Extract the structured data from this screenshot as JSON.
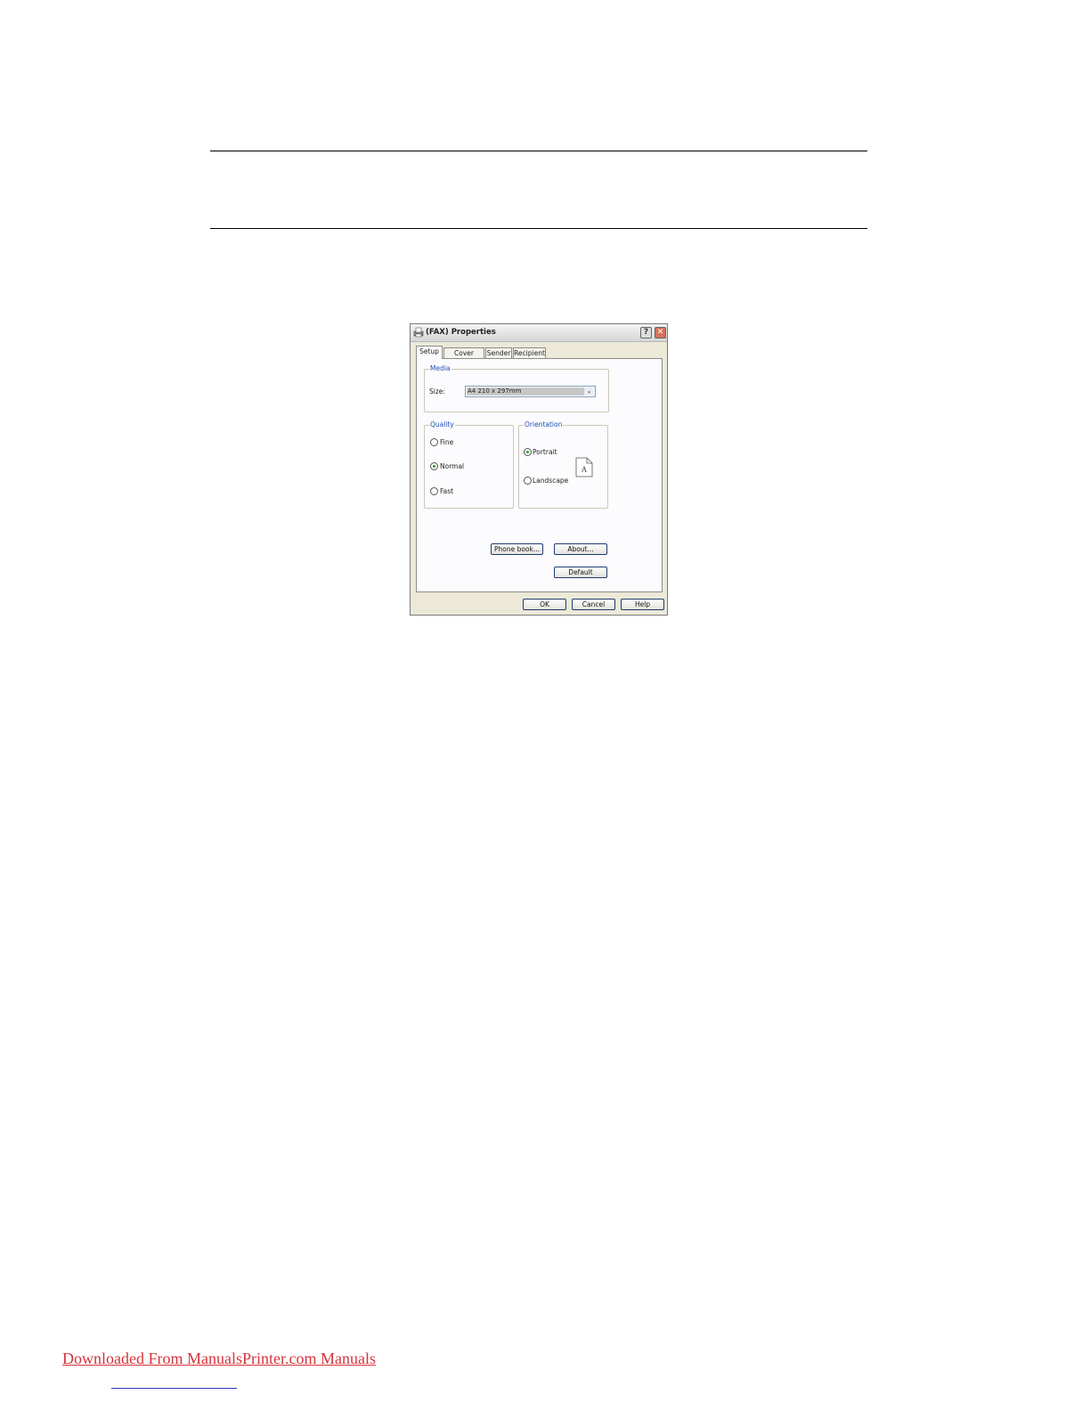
{
  "dialog": {
    "title": "(FAX) Properties",
    "help_button": "?",
    "close_button": "✕",
    "tabs": [
      {
        "label": "Setup",
        "active": true
      },
      {
        "label": "Cover Sheet",
        "active": false
      },
      {
        "label": "Sender",
        "active": false
      },
      {
        "label": "Recipient",
        "active": false
      }
    ],
    "media": {
      "legend": "Media",
      "size_label": "Size:",
      "size_value": "A4 210 x 297mm"
    },
    "quality": {
      "legend": "Quality",
      "options": [
        {
          "label": "Fine",
          "checked": false
        },
        {
          "label": "Normal",
          "checked": true
        },
        {
          "label": "Fast",
          "checked": false
        }
      ]
    },
    "orientation": {
      "legend": "Orientation",
      "options": [
        {
          "label": "Portrait",
          "checked": true
        },
        {
          "label": "Landscape",
          "checked": false
        }
      ],
      "preview_letter": "A"
    },
    "buttons": {
      "phone_book": "Phone book...",
      "about": "About...",
      "default": "Default",
      "ok": "OK",
      "cancel": "Cancel",
      "help": "Help"
    }
  },
  "footer": {
    "link_text": "Downloaded From ManualsPrinter.com Manuals",
    "link_color": "#d6333a"
  },
  "colors": {
    "dialog_bg": "#ece9d8",
    "group_legend": "#1f4fb4",
    "radio_dot": "#2a9b2a"
  }
}
